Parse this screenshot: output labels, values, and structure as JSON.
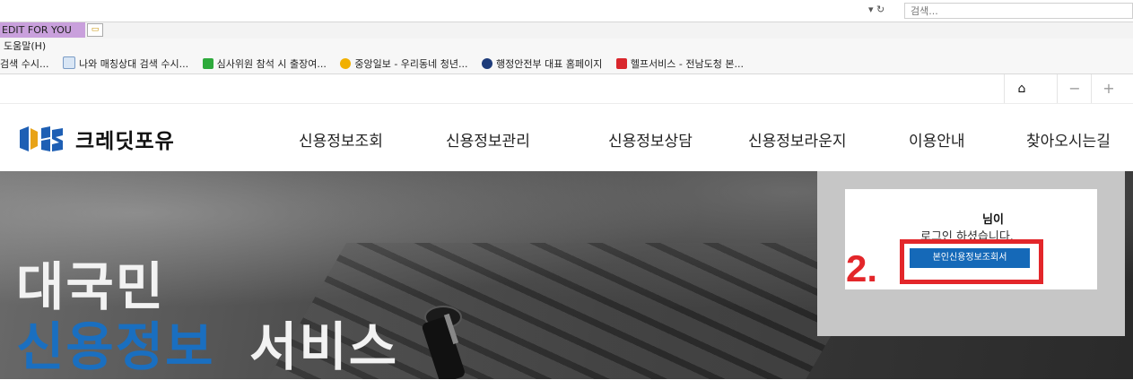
{
  "browser": {
    "address_controls": "▾ ↻",
    "search_placeholder": "검색...",
    "tab_title": "EDIT FOR YOU",
    "menu_help": "도움말(H)",
    "favorites": [
      {
        "label": "검색  수시...",
        "icon": "page-icon",
        "color": "#f7f7f7"
      },
      {
        "label": "나와 매칭상대 검색  수시...",
        "icon": "page-icon",
        "color": "#d9e6f5"
      },
      {
        "label": "심사위원 참석 시 출장여...",
        "icon": "green-site-icon",
        "color": "#2eaa3c"
      },
      {
        "label": "중앙일보 - 우리동네 청년...",
        "icon": "joongang-icon",
        "color": "#f1b000"
      },
      {
        "label": "행정안전부 대표 홈페이지",
        "icon": "gov-icon",
        "color": "#1e3c7a"
      },
      {
        "label": "헬프서비스 - 전남도청 본...",
        "icon": "red-site-icon",
        "color": "#d9262c"
      }
    ]
  },
  "site": {
    "utility": {
      "home": "⌂",
      "zoom_out": "−",
      "zoom_in": "+"
    },
    "logo_text": "크레딧포유",
    "nav": [
      "신용정보조회",
      "신용정보관리",
      "신용정보상담",
      "신용정보라운지",
      "이용안내",
      "찾아오시는길"
    ],
    "hero": {
      "line1": "대국민",
      "line2_highlight": "신용정보",
      "line2_rest": "서비스",
      "highlight_color": "#1a6fc0"
    },
    "login": {
      "name_suffix": "님이",
      "message": "로그인 하셨습니다.",
      "button": "본인신용정보조회서",
      "step": "2."
    }
  }
}
